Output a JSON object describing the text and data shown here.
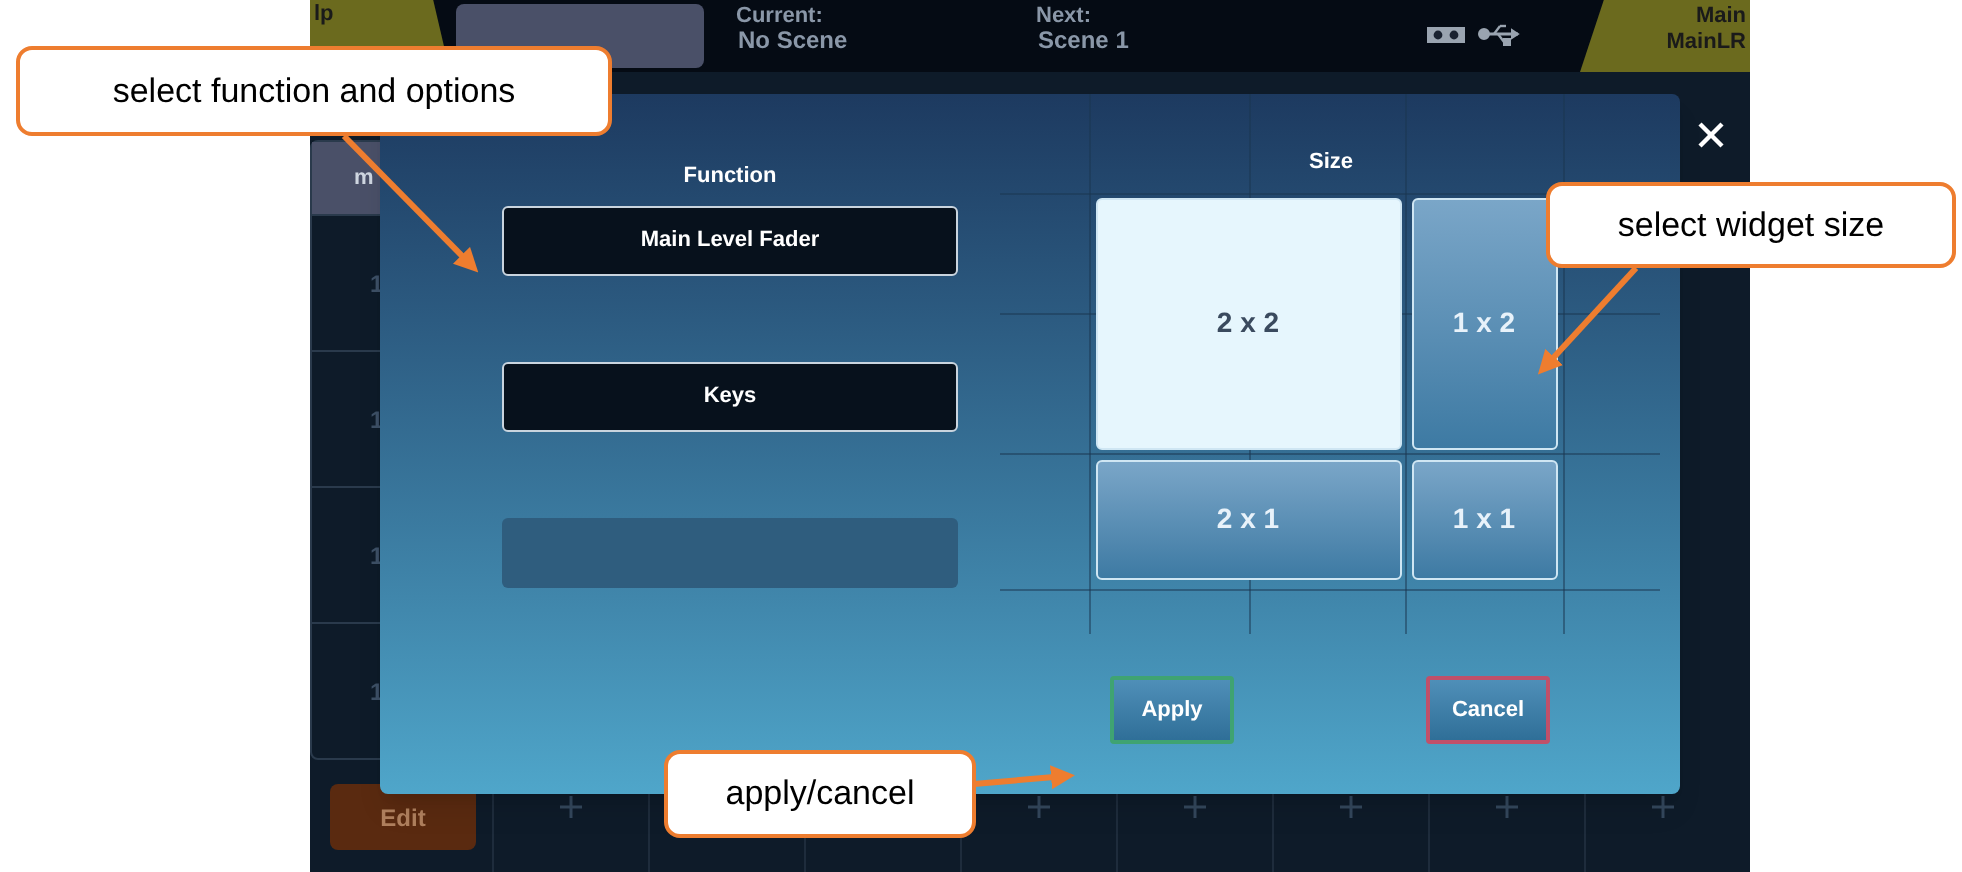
{
  "top_bar": {
    "layer": "lp",
    "current_label": "Current:",
    "current_value": "No Scene",
    "next_label": "Next:",
    "next_value": "Scene 1",
    "main_label": "Main",
    "main_value": "MainLR"
  },
  "side_tab": "m",
  "background_rows": [
    "1",
    "1",
    "1",
    "1"
  ],
  "edit_button": "Edit",
  "dialog": {
    "function_title": "Function",
    "function_options": [
      {
        "label": "Main Level Fader",
        "disabled": false
      },
      {
        "label": "Keys",
        "disabled": false
      },
      {
        "disabled": true
      }
    ],
    "size_title": "Size",
    "sizes": [
      {
        "label": "2 x 2",
        "kind": "large",
        "selected": true
      },
      {
        "label": "1 x 2",
        "kind": "tall",
        "selected": false
      },
      {
        "label": "2 x 1",
        "kind": "wide",
        "selected": false
      },
      {
        "label": "1 x 1",
        "kind": "small",
        "selected": false
      }
    ],
    "buttons": [
      {
        "label": "Apply",
        "kind": "apply"
      },
      {
        "label": "Cancel",
        "kind": "cancel"
      }
    ]
  },
  "callouts": [
    {
      "text": "select function and options"
    },
    {
      "text": "select widget size"
    },
    {
      "text": "apply/cancel"
    }
  ]
}
